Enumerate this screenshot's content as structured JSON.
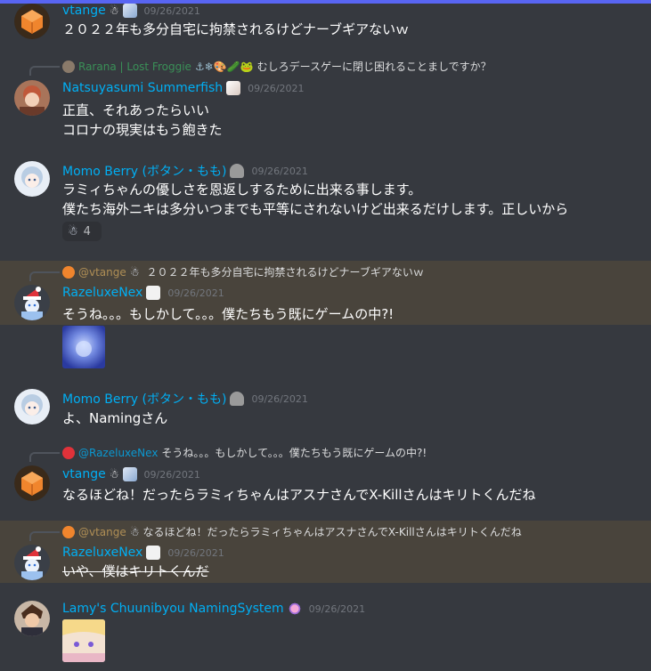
{
  "messages": [
    {
      "username": "vtange",
      "name_emoji": "☃",
      "timestamp": "09/26/2021",
      "lines": [
        "２０２２年も多分自宅に拘禁されるけどナーブギアないｗ"
      ]
    },
    {
      "reply": {
        "username": "Rarana | Lost Froggie",
        "emojis": "⚓❄🎨🥒🐸",
        "text": "むしろデースゲーに閉じ困れることましですか？"
      },
      "username": "Natsuyasumi Summerfish",
      "timestamp": "09/26/2021",
      "lines": [
        "正直、それあったらいい",
        "コロナの現実はもう飽きた"
      ]
    },
    {
      "username": "Momo Berry (ボタン・もも)",
      "timestamp": "09/26/2021",
      "lines": [
        "ラミィちゃんの優しさを恩返しするために出来る事します。",
        "僕たち海外ニキは多分いつまでも平等にされないけど出来るだけします。正しいから"
      ],
      "reaction": {
        "emoji": "☃",
        "count": "4"
      }
    },
    {
      "reply": {
        "username": "@vtange",
        "emojis": "☃",
        "text": "２０２２年も多分自宅に拘禁されるけどナーブギアないｗ"
      },
      "username": "RazeluxeNex",
      "timestamp": "09/26/2021",
      "lines": [
        "そうね。。。もしかして。。。僕たちもう既にゲームの中?!"
      ]
    },
    {
      "username": "Momo Berry (ボタン・もも)",
      "timestamp": "09/26/2021",
      "lines": [
        "よ、Namingさん"
      ]
    },
    {
      "reply": {
        "username": "@RazeluxeNex",
        "text": "そうね。。。もしかして。。。僕たちもう既にゲームの中?!"
      },
      "username": "vtange",
      "name_emoji": "☃",
      "timestamp": "09/26/2021",
      "lines": [
        "なるほどね！だったらラミィちゃんはアスナさんでX-Killさんはキリトくんだね"
      ]
    },
    {
      "reply": {
        "username": "@vtange",
        "emojis": "☃",
        "text": "なるほどね！だったらラミィちゃんはアスナさんでX-Killさんはキリトくんだね"
      },
      "username": "RazeluxeNex",
      "timestamp": "09/26/2021",
      "lines": [
        "いや、僕はキリトくんだ"
      ]
    },
    {
      "username": "Lamy's Chuunibyou NamingSystem",
      "timestamp": "09/26/2021",
      "lines": []
    }
  ]
}
